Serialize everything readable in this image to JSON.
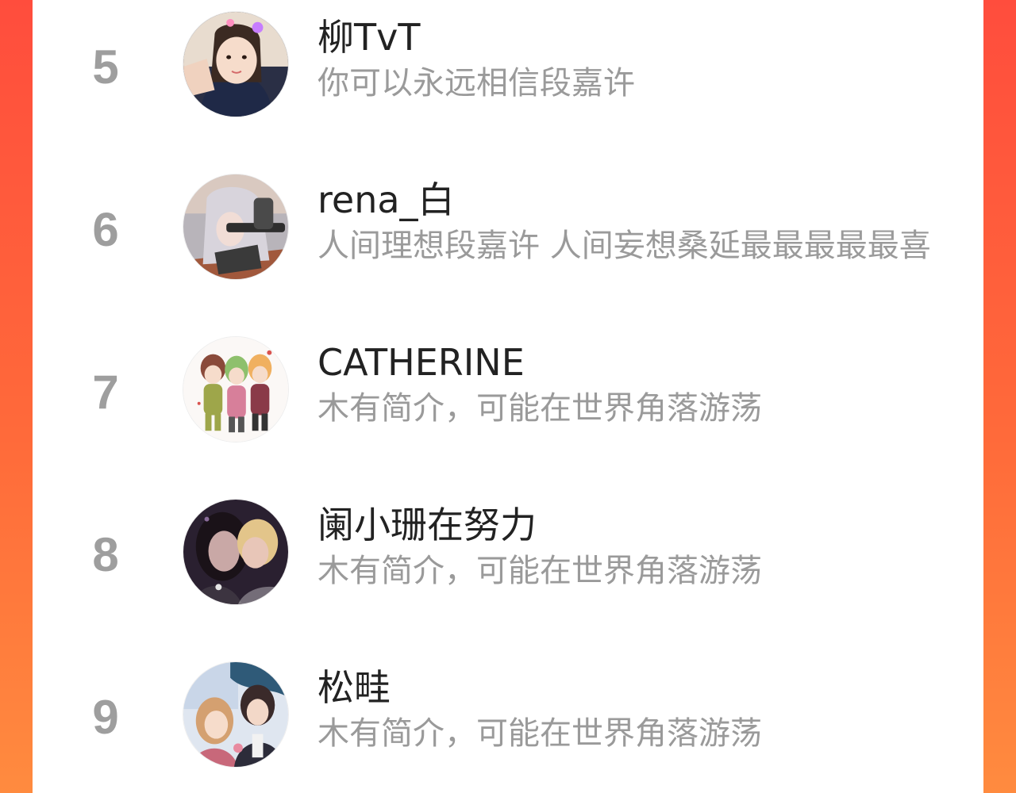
{
  "ranking": {
    "items": [
      {
        "rank": "5",
        "name": "柳TvT",
        "bio": "你可以永远相信段嘉许"
      },
      {
        "rank": "6",
        "name": "rena_白",
        "bio": "人间理想段嘉许 人间妄想桑延最最最最最喜"
      },
      {
        "rank": "7",
        "name": "CATHERINE",
        "bio": "木有简介，可能在世界角落游荡"
      },
      {
        "rank": "8",
        "name": "阑小珊在努力",
        "bio": "木有简介，可能在世界角落游荡"
      },
      {
        "rank": "9",
        "name": "松畦",
        "bio": "木有简介，可能在世界角落游荡"
      }
    ]
  },
  "colors": {
    "background_gradient_top": "#ff4d3d",
    "background_gradient_bottom": "#ff8b3f",
    "card": "#ffffff",
    "rank_text": "#9e9e9e",
    "name_text": "#222222",
    "bio_text": "#9a9a9a"
  }
}
